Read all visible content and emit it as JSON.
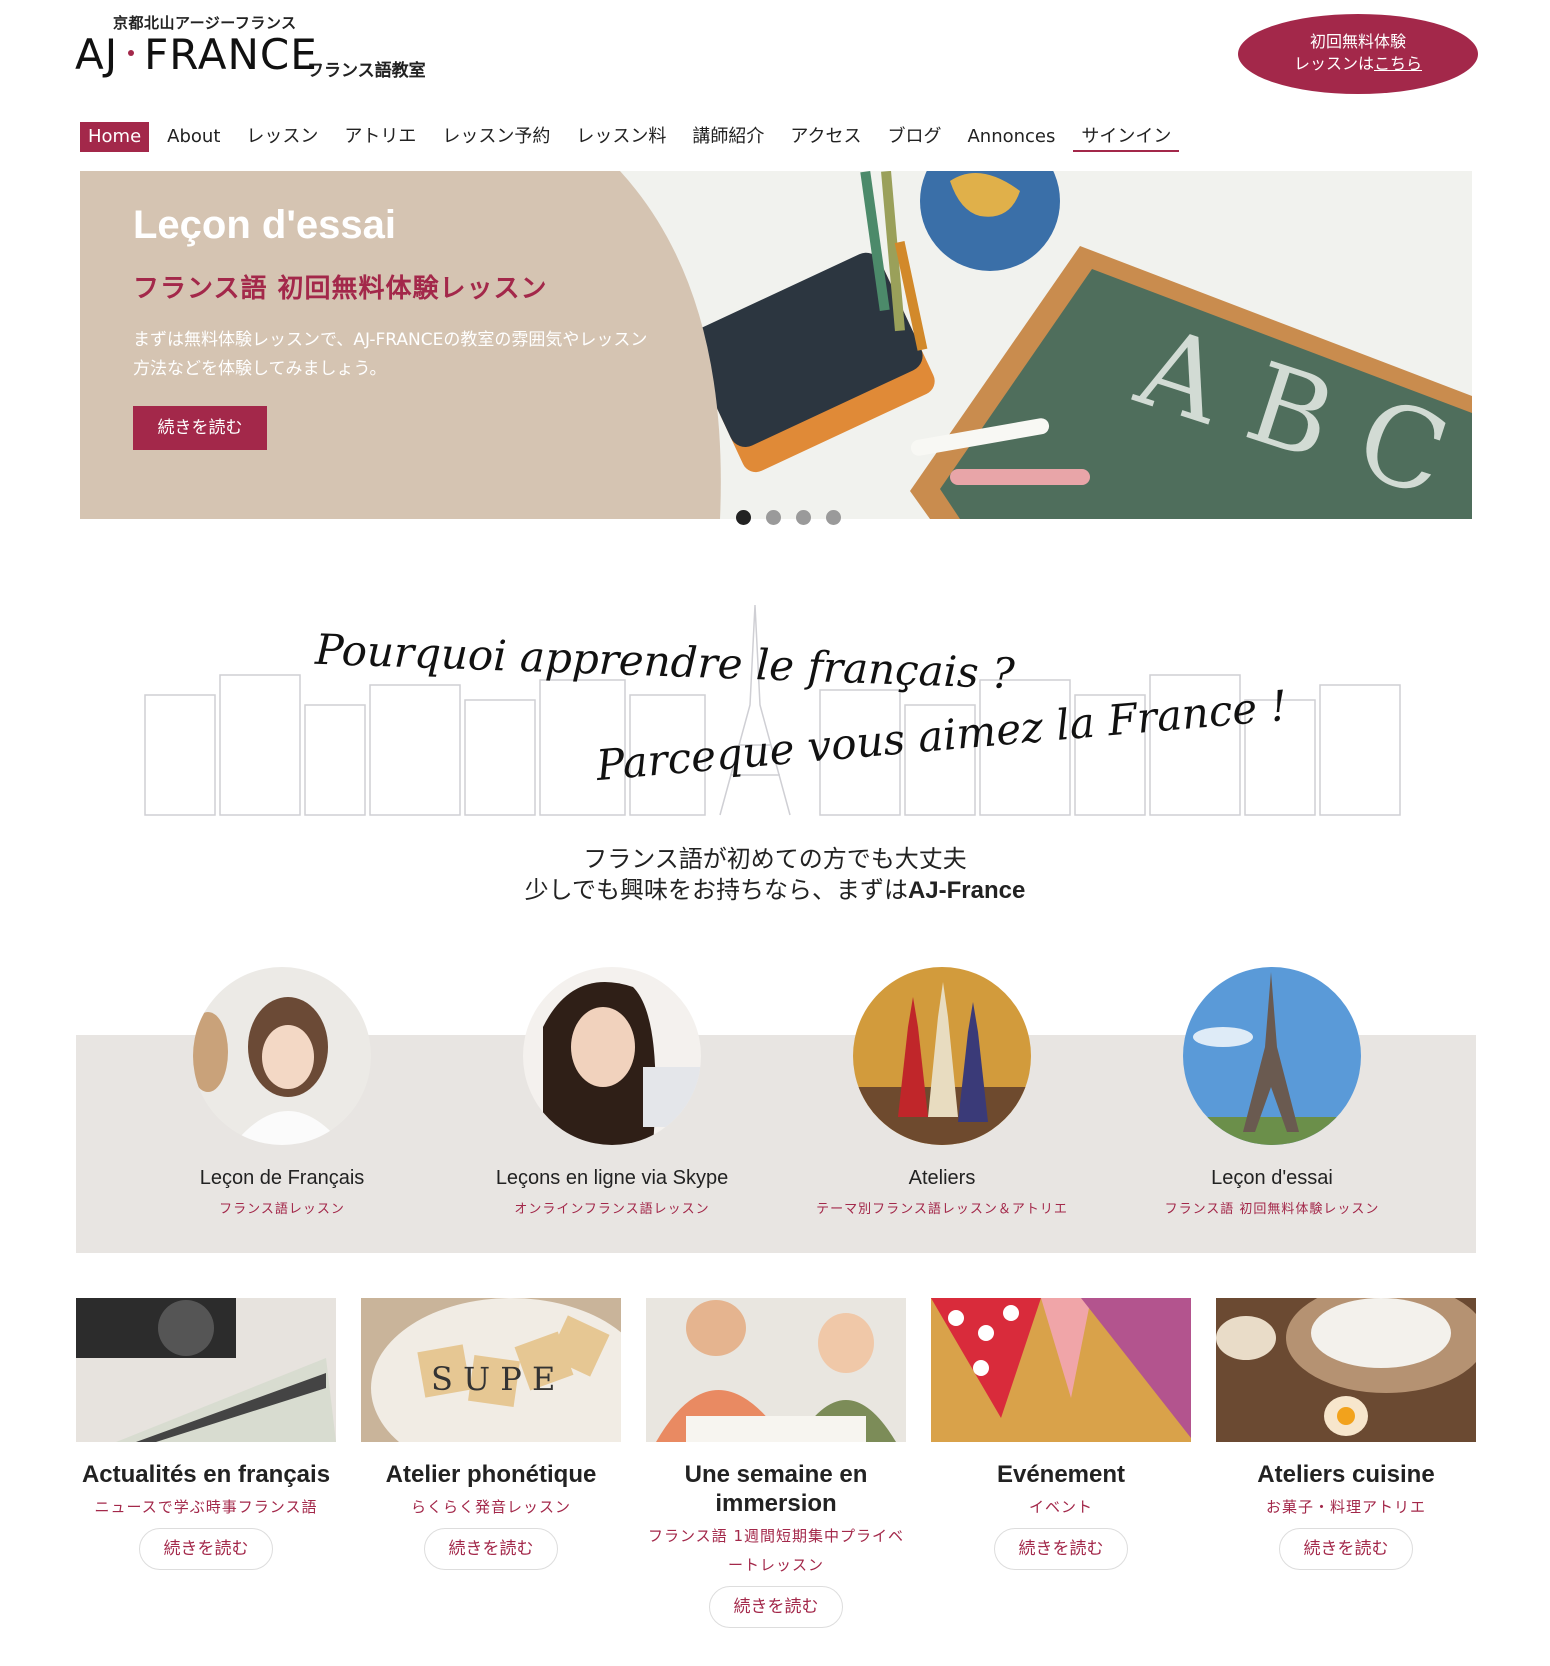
{
  "header": {
    "logo_top": "京都北山アージーフランス",
    "logo_left": "AJ",
    "logo_right": "FRANCE",
    "logo_sub": "フランス語教室",
    "cta_line1": "初回無料体験",
    "cta_line2_prefix": "レッスンは",
    "cta_line2_link": "こちら"
  },
  "nav": {
    "items": [
      {
        "label": "Home"
      },
      {
        "label": "About"
      },
      {
        "label": "レッスン"
      },
      {
        "label": "アトリエ"
      },
      {
        "label": "レッスン予約"
      },
      {
        "label": "レッスン料"
      },
      {
        "label": "講師紹介"
      },
      {
        "label": "アクセス"
      },
      {
        "label": "ブログ"
      },
      {
        "label": "Annonces"
      },
      {
        "label": "サインイン"
      }
    ]
  },
  "hero": {
    "title": "Leçon d'essai",
    "subtitle": "フランス語 初回無料体験レッスン",
    "text": "まずは無料体験レッスンで、AJ-FRANCEの教室の雰囲気やレッスン方法などを体験してみましょう。",
    "button": "続きを読む",
    "slide_count": 4,
    "active_slide": 1,
    "chalk_text": "A B C"
  },
  "motto": {
    "line1": "Pourquoi apprendre le français ?",
    "line2": "Parceque vous aimez la France !"
  },
  "intro": {
    "line1": "フランス語が初めての方でも大丈夫",
    "line2_prefix": "少しでも興味をお持ちなら、まずは",
    "line2_brand": "AJ-France"
  },
  "features": [
    {
      "title": "Leçon de Français",
      "subtitle": "フランス語レッスン",
      "icon": "students-photo"
    },
    {
      "title": "Leçons en ligne via Skype",
      "subtitle": "オンラインフランス語レッスン",
      "icon": "woman-laptop-photo"
    },
    {
      "title": "Ateliers",
      "subtitle": "テーマ別フランス語レッスン＆アトリエ",
      "icon": "eiffel-figurines-photo"
    },
    {
      "title": "Leçon d'essai",
      "subtitle": "フランス語 初回無料体験レッスン",
      "icon": "eiffel-tower-photo"
    }
  ],
  "cards": [
    {
      "title": "Actualités en français",
      "subtitle": "ニュースで学ぶ時事フランス語",
      "button": "続きを読む",
      "icon": "camera-map-photo"
    },
    {
      "title": "Atelier phonétique",
      "subtitle": "らくらく発音レッスン",
      "button": "続きを読む",
      "icon": "letter-tiles-photo",
      "tiles": "S U P E"
    },
    {
      "title": "Une semaine en immersion",
      "subtitle": "フランス語 1週間短期集中プライベートレッスン",
      "button": "続きを読む",
      "icon": "studying-people-photo"
    },
    {
      "title": "Evénement",
      "subtitle": "イベント",
      "button": "続きを読む",
      "icon": "bunting-flags-photo"
    },
    {
      "title": "Ateliers cuisine",
      "subtitle": "お菓子・料理アトリエ",
      "button": "続きを読む",
      "icon": "baking-photo"
    }
  ],
  "colors": {
    "brand": "#a3284a",
    "band_bg": "#e8e5e2",
    "hero_panel": "#d5c4b2"
  }
}
